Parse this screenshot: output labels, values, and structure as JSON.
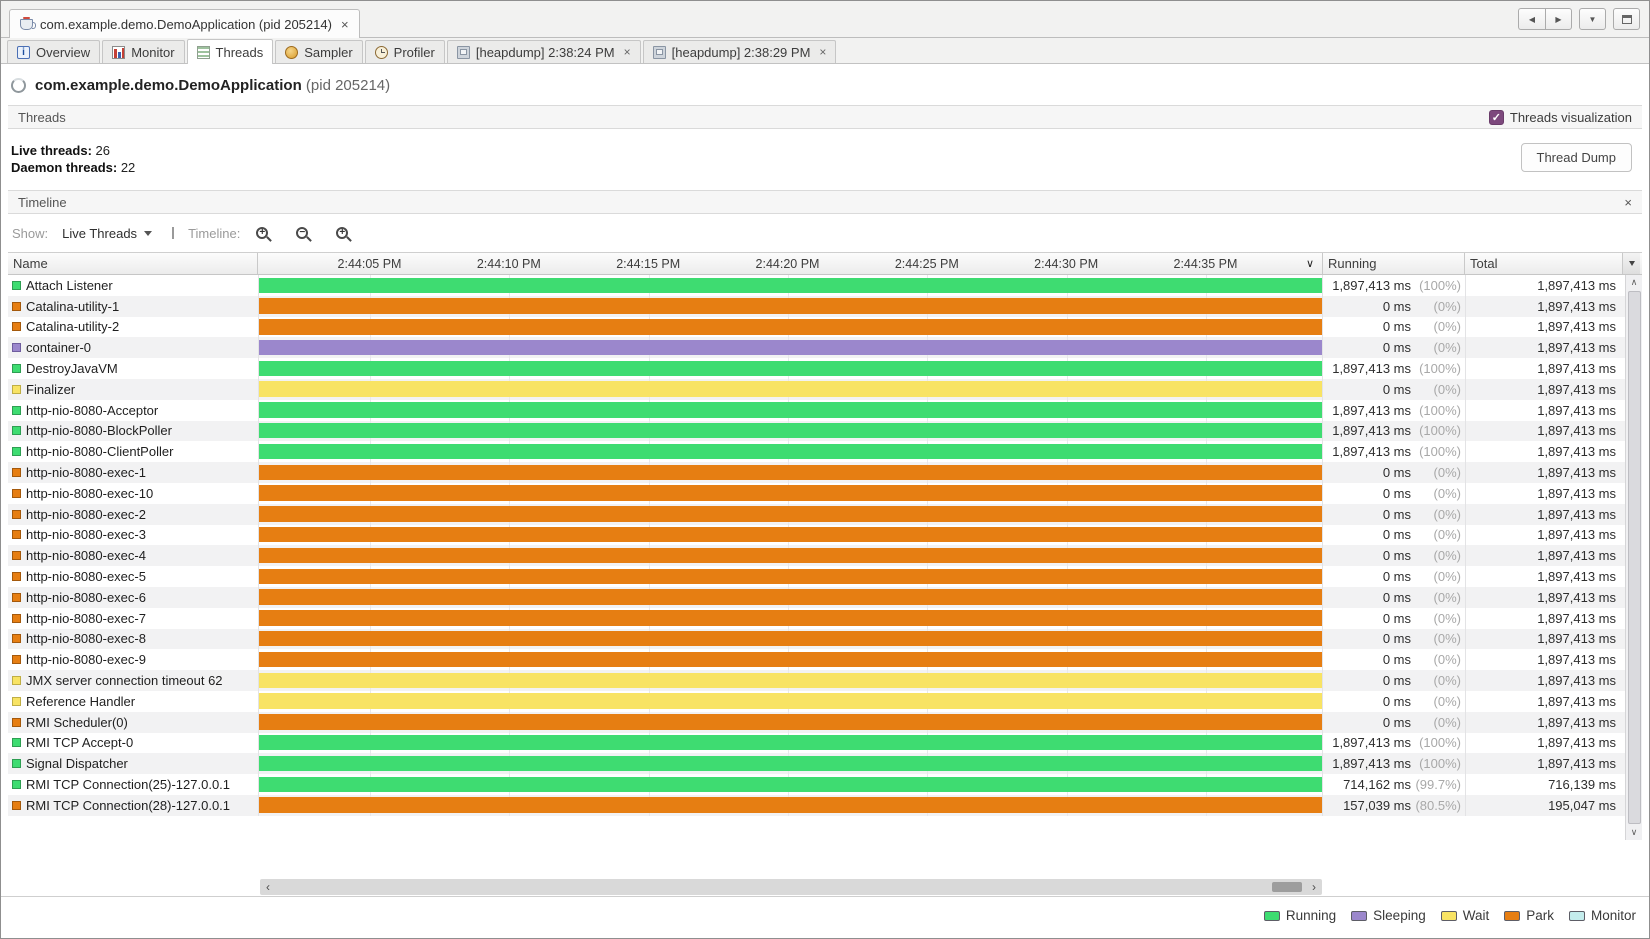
{
  "window": {
    "tab_title": "com.example.demo.DemoApplication (pid 205214)",
    "close_glyph": "×",
    "controls": {
      "back": "◀",
      "forward": "▶",
      "list": "▼"
    }
  },
  "tabs": [
    {
      "label": "Overview",
      "icon": "overview"
    },
    {
      "label": "Monitor",
      "icon": "monitor"
    },
    {
      "label": "Threads",
      "icon": "threads",
      "active": true
    },
    {
      "label": "Sampler",
      "icon": "sampler"
    },
    {
      "label": "Profiler",
      "icon": "profiler"
    },
    {
      "label": "[heapdump] 2:38:24 PM",
      "icon": "heapdump",
      "closable": true
    },
    {
      "label": "[heapdump] 2:38:29 PM",
      "icon": "heapdump",
      "closable": true
    }
  ],
  "header": {
    "app": "com.example.demo.DemoApplication",
    "pid": "(pid 205214)"
  },
  "threads_panel": {
    "title": "Threads",
    "visualization_label": "Threads visualization",
    "checkbox_glyph": "✓",
    "live_label": "Live threads:",
    "live_value": "26",
    "daemon_label": "Daemon threads:",
    "daemon_value": "22",
    "dump_button": "Thread Dump"
  },
  "timeline_panel": {
    "title": "Timeline",
    "close_glyph": "×",
    "show_label": "Show:",
    "show_value": "Live Threads",
    "timeline_label": "Timeline:",
    "zoom_in_sign": "+",
    "zoom_out_sign": "−",
    "zoom_fit_sign": "+"
  },
  "table": {
    "name_col": "Name",
    "running_col": "Running",
    "total_col": "Total",
    "sort_glyph": "∨",
    "time_ticks": [
      "2:44:05 PM",
      "2:44:10 PM",
      "2:44:15 PM",
      "2:44:20 PM",
      "2:44:25 PM",
      "2:44:30 PM",
      "2:44:35 PM"
    ],
    "rows": [
      {
        "name": "Attach Listener",
        "state": "running",
        "running": "1,897,413 ms",
        "running_pct": "(100%)",
        "total": "1,897,413 ms"
      },
      {
        "name": "Catalina-utility-1",
        "state": "park",
        "running": "0 ms",
        "running_pct": "(0%)",
        "total": "1,897,413 ms"
      },
      {
        "name": "Catalina-utility-2",
        "state": "park",
        "running": "0 ms",
        "running_pct": "(0%)",
        "total": "1,897,413 ms"
      },
      {
        "name": "container-0",
        "state": "sleeping",
        "running": "0 ms",
        "running_pct": "(0%)",
        "total": "1,897,413 ms"
      },
      {
        "name": "DestroyJavaVM",
        "state": "running",
        "running": "1,897,413 ms",
        "running_pct": "(100%)",
        "total": "1,897,413 ms"
      },
      {
        "name": "Finalizer",
        "state": "wait",
        "running": "0 ms",
        "running_pct": "(0%)",
        "total": "1,897,413 ms"
      },
      {
        "name": "http-nio-8080-Acceptor",
        "state": "running",
        "running": "1,897,413 ms",
        "running_pct": "(100%)",
        "total": "1,897,413 ms"
      },
      {
        "name": "http-nio-8080-BlockPoller",
        "state": "running",
        "running": "1,897,413 ms",
        "running_pct": "(100%)",
        "total": "1,897,413 ms"
      },
      {
        "name": "http-nio-8080-ClientPoller",
        "state": "running",
        "running": "1,897,413 ms",
        "running_pct": "(100%)",
        "total": "1,897,413 ms"
      },
      {
        "name": "http-nio-8080-exec-1",
        "state": "park",
        "running": "0 ms",
        "running_pct": "(0%)",
        "total": "1,897,413 ms"
      },
      {
        "name": "http-nio-8080-exec-10",
        "state": "park",
        "running": "0 ms",
        "running_pct": "(0%)",
        "total": "1,897,413 ms"
      },
      {
        "name": "http-nio-8080-exec-2",
        "state": "park",
        "running": "0 ms",
        "running_pct": "(0%)",
        "total": "1,897,413 ms"
      },
      {
        "name": "http-nio-8080-exec-3",
        "state": "park",
        "running": "0 ms",
        "running_pct": "(0%)",
        "total": "1,897,413 ms"
      },
      {
        "name": "http-nio-8080-exec-4",
        "state": "park",
        "running": "0 ms",
        "running_pct": "(0%)",
        "total": "1,897,413 ms"
      },
      {
        "name": "http-nio-8080-exec-5",
        "state": "park",
        "running": "0 ms",
        "running_pct": "(0%)",
        "total": "1,897,413 ms"
      },
      {
        "name": "http-nio-8080-exec-6",
        "state": "park",
        "running": "0 ms",
        "running_pct": "(0%)",
        "total": "1,897,413 ms"
      },
      {
        "name": "http-nio-8080-exec-7",
        "state": "park",
        "running": "0 ms",
        "running_pct": "(0%)",
        "total": "1,897,413 ms"
      },
      {
        "name": "http-nio-8080-exec-8",
        "state": "park",
        "running": "0 ms",
        "running_pct": "(0%)",
        "total": "1,897,413 ms"
      },
      {
        "name": "http-nio-8080-exec-9",
        "state": "park",
        "running": "0 ms",
        "running_pct": "(0%)",
        "total": "1,897,413 ms"
      },
      {
        "name": "JMX server connection timeout 62",
        "state": "wait",
        "running": "0 ms",
        "running_pct": "(0%)",
        "total": "1,897,413 ms"
      },
      {
        "name": "Reference Handler",
        "state": "wait",
        "running": "0 ms",
        "running_pct": "(0%)",
        "total": "1,897,413 ms"
      },
      {
        "name": "RMI Scheduler(0)",
        "state": "park",
        "running": "0 ms",
        "running_pct": "(0%)",
        "total": "1,897,413 ms"
      },
      {
        "name": "RMI TCP Accept-0",
        "state": "running",
        "running": "1,897,413 ms",
        "running_pct": "(100%)",
        "total": "1,897,413 ms"
      },
      {
        "name": "Signal Dispatcher",
        "state": "running",
        "running": "1,897,413 ms",
        "running_pct": "(100%)",
        "total": "1,897,413 ms"
      },
      {
        "name": "RMI TCP Connection(25)-127.0.0.1",
        "state": "running",
        "running": "714,162 ms",
        "running_pct": "(99.7%)",
        "total": "716,139 ms"
      },
      {
        "name": "RMI TCP Connection(28)-127.0.0.1",
        "state": "park",
        "running": "157,039 ms",
        "running_pct": "(80.5%)",
        "total": "195,047 ms"
      }
    ]
  },
  "scrollbars": {
    "left": "‹",
    "right": "›",
    "up": "∧",
    "down": "∨"
  },
  "legend": [
    {
      "label": "Running",
      "color": "#3edc71"
    },
    {
      "label": "Sleeping",
      "color": "#9b87cc"
    },
    {
      "label": "Wait",
      "color": "#f8e364"
    },
    {
      "label": "Park",
      "color": "#e67e12"
    },
    {
      "label": "Monitor",
      "color": "#c4eded"
    }
  ],
  "colors": {
    "states": {
      "running": {
        "fill": "#3edc71",
        "border": "#2e9e52"
      },
      "park": {
        "fill": "#e67e12",
        "border": "#a4590c"
      },
      "sleeping": {
        "fill": "#9b87cc",
        "border": "#6f5d9e"
      },
      "wait": {
        "fill": "#f8e364",
        "border": "#bfae45"
      },
      "monitor": {
        "fill": "#c4eded",
        "border": "#7fb3b3"
      }
    }
  }
}
